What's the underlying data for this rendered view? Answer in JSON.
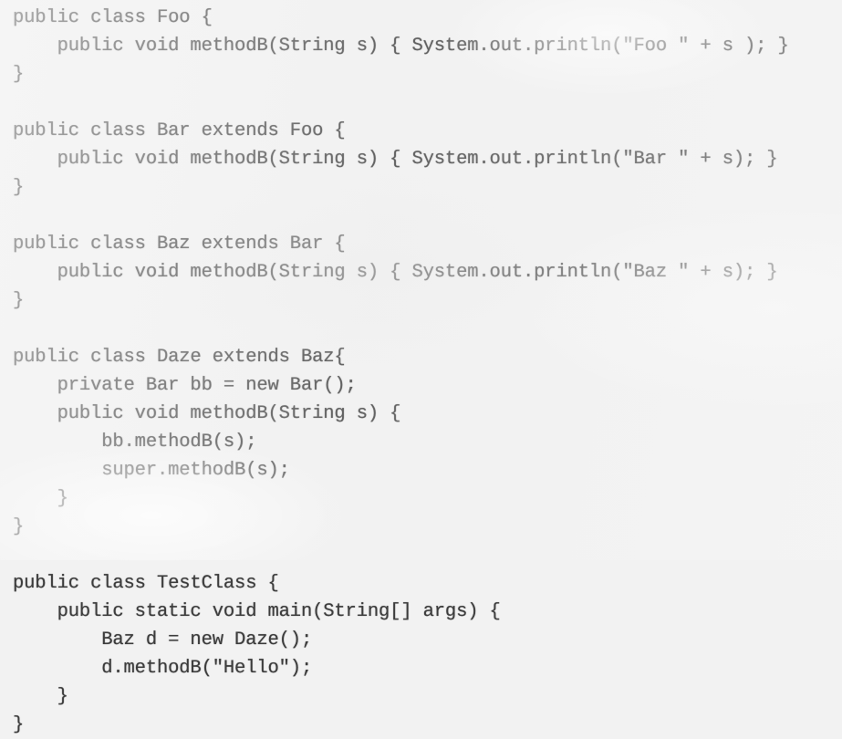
{
  "document": {
    "kind": "java-source-listing",
    "language": "Java",
    "background_color": "#f2f2f2",
    "text_color": "#3c3c3c",
    "line_count": 28
  },
  "code": {
    "lines": [
      "public class Foo {",
      "    public void methodB(String s) { System.out.println(\"Foo \" + s ); }",
      "}",
      "",
      "public class Bar extends Foo {",
      "    public void methodB(String s) { System.out.println(\"Bar \" + s); }",
      "}",
      "",
      "public class Baz extends Bar {",
      "    public void methodB(String s) { System.out.println(\"Baz \" + s); }",
      "}",
      "",
      "public class Daze extends Baz{",
      "    private Bar bb = new Bar();",
      "    public void methodB(String s) {",
      "        bb.methodB(s);",
      "        super.methodB(s);",
      "    }",
      "}",
      "",
      "public class TestClass {",
      "    public static void main(String[] args) {",
      "        Baz d = new Daze();",
      "        d.methodB(\"Hello\");",
      "    }",
      "}"
    ]
  }
}
